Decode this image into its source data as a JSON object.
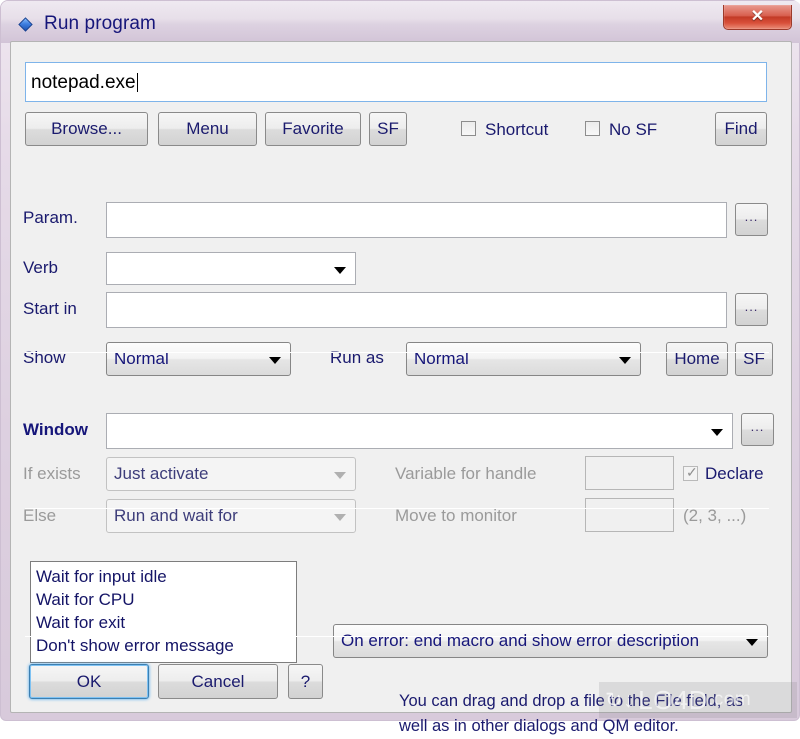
{
  "window": {
    "title": "Run program",
    "icon": "diamond-icon",
    "close_label": "✕",
    "accent": "#16167a",
    "frame_color": "#ddd0e0"
  },
  "file_field": {
    "value": "notepad.exe",
    "placeholder": ""
  },
  "toolbar": {
    "browse_label": "Browse...",
    "menu_label": "Menu",
    "favorite_label": "Favorite",
    "sf_label": "SF",
    "find_label": "Find",
    "shortcut_label": "Shortcut",
    "shortcut_checked": false,
    "no_sf_label": "No SF",
    "no_sf_checked": false
  },
  "fields": {
    "param_label": "Param.",
    "param_value": "",
    "param_browse": "...",
    "verb_label": "Verb",
    "verb_value": "",
    "start_in_label": "Start in",
    "start_in_value": "",
    "start_in_browse": "...",
    "show_label": "Show",
    "show_value": "Normal",
    "run_as_label": "Run as",
    "run_as_value": "Normal",
    "home_label": "Home",
    "sf_label": "SF"
  },
  "window_section": {
    "window_label": "Window",
    "window_value": "",
    "window_browse": "...",
    "if_exists_label": "If exists",
    "if_exists_value": "Just activate",
    "else_label": "Else",
    "else_value": "Run and wait for",
    "variable_for_handle_label": "Variable for handle",
    "variable_for_handle_value": "",
    "declare_label": "Declare",
    "declare_checked": true,
    "move_to_monitor_label": "Move to monitor",
    "move_to_monitor_value": "",
    "monitor_hint": "(2, 3, ...)"
  },
  "options_list": {
    "items": [
      "Wait for input idle",
      "Wait for CPU",
      "Wait for exit",
      "Don't show error message"
    ]
  },
  "error_combo": {
    "value": "On error: end macro and show error description"
  },
  "footer": {
    "ok_label": "OK",
    "cancel_label": "Cancel",
    "help_label": "?",
    "hint_line1": "You can drag and drop a file to the File field, as",
    "hint_line2": "well as in other dialogs and QM editor."
  },
  "watermark": {
    "brand": "LO4D",
    "domain": ".com"
  }
}
